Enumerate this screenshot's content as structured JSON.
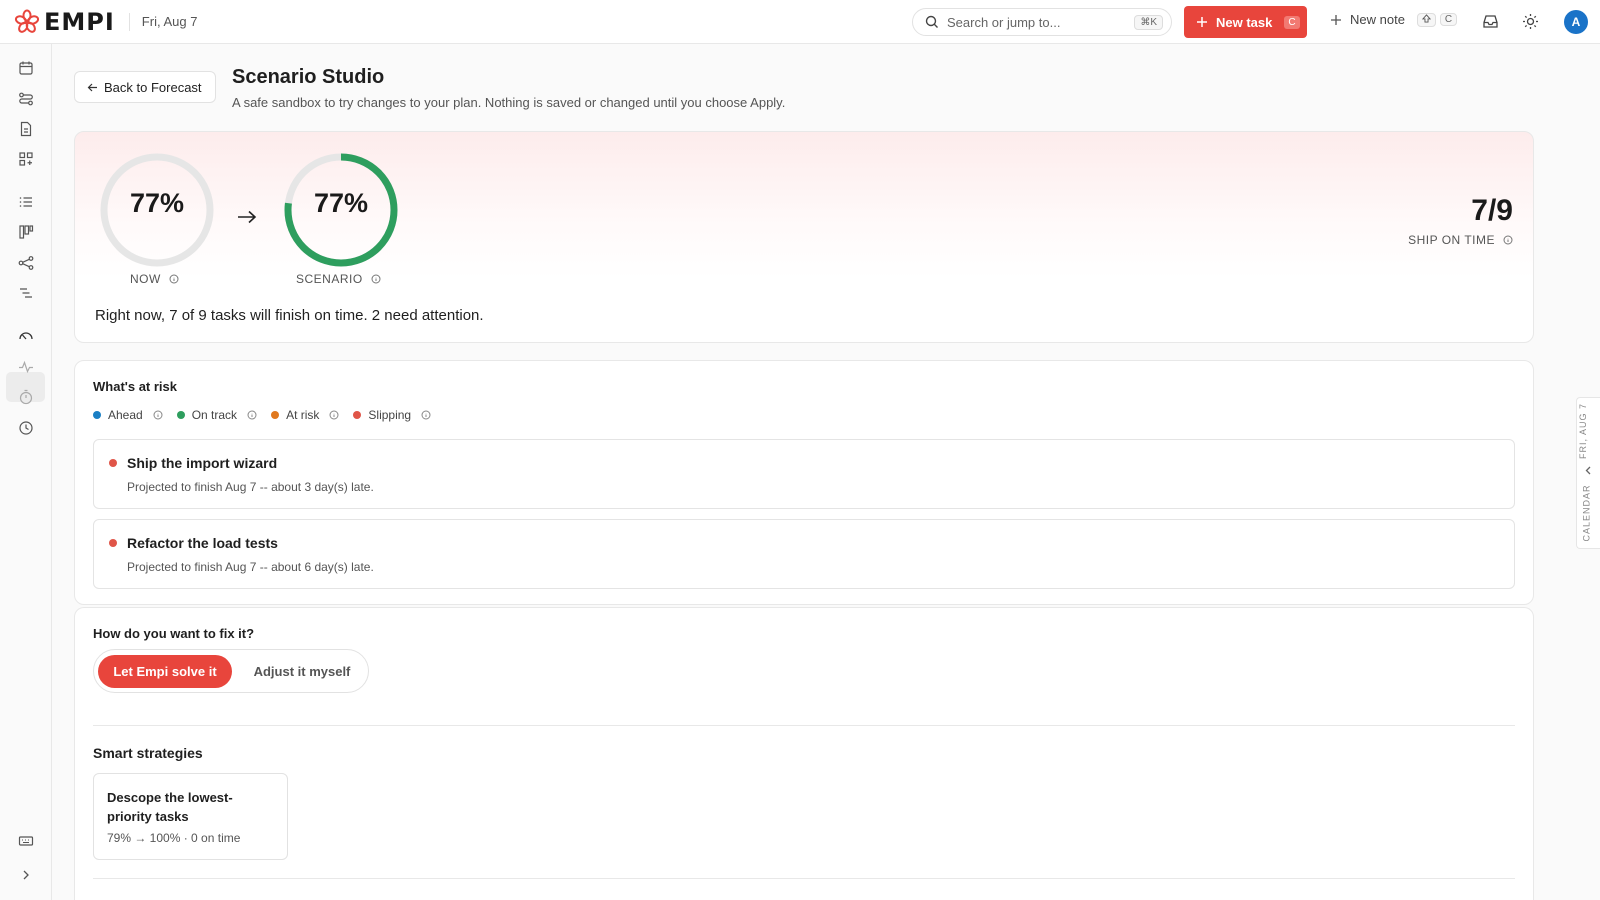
{
  "topbar": {
    "brand": "EMPI",
    "date": "Fri, Aug 7",
    "search_placeholder": "Search or jump to...",
    "search_shortcut": "⌘K",
    "new_task_label": "New task",
    "new_task_shortcut": "C",
    "new_note_label": "New note",
    "new_note_shortcut_key": "C",
    "avatar_initial": "A",
    "brand_color": "#e8453c"
  },
  "sidebar": {
    "icons": [
      "calendar-icon",
      "flows-icon",
      "document-icon",
      "apps-grid-icon",
      "list-icon",
      "board-icon",
      "graph-icon",
      "outline-icon",
      "forecast-gauge-icon",
      "pulse-icon",
      "timer-icon",
      "clock-icon",
      "keyboard-icon",
      "expand-icon"
    ]
  },
  "right_rail": {
    "date": "FRI, AUG 7",
    "label": "CALENDAR"
  },
  "header": {
    "back_label": "Back to Forecast",
    "title": "Scenario Studio",
    "subtitle": "A safe sandbox to try changes to your plan. Nothing is saved or changed until you choose Apply."
  },
  "hero": {
    "now_pct": "77%",
    "now_value": 77,
    "now_label": "NOW",
    "scenario_pct": "77%",
    "scenario_value": 77,
    "scenario_label": "SCENARIO",
    "ship_value": "7/9",
    "ship_label": "SHIP ON TIME",
    "summary": "Right now, 7 of 9 tasks will finish on time. 2 need attention."
  },
  "risk": {
    "title": "What's at risk",
    "legend": [
      {
        "label": "Ahead",
        "color": "#1a7fc4"
      },
      {
        "label": "On track",
        "color": "#2e9e5e"
      },
      {
        "label": "At risk",
        "color": "#e0781e"
      },
      {
        "label": "Slipping",
        "color": "#e05548"
      }
    ],
    "items": [
      {
        "name": "Ship the import wizard",
        "desc": "Projected to finish Aug 7 -- about 3 day(s) late."
      },
      {
        "name": "Refactor the load tests",
        "desc": "Projected to finish Aug 7 -- about 6 day(s) late."
      }
    ]
  },
  "fix": {
    "title": "How do you want to fix it?",
    "option_auto": "Let Empi solve it",
    "option_manual": "Adjust it myself",
    "strategies_title": "Smart strategies",
    "strategies": [
      {
        "name": "Descope the lowest-priority tasks",
        "meta": "79% → 100% · 0 on time"
      }
    ]
  }
}
